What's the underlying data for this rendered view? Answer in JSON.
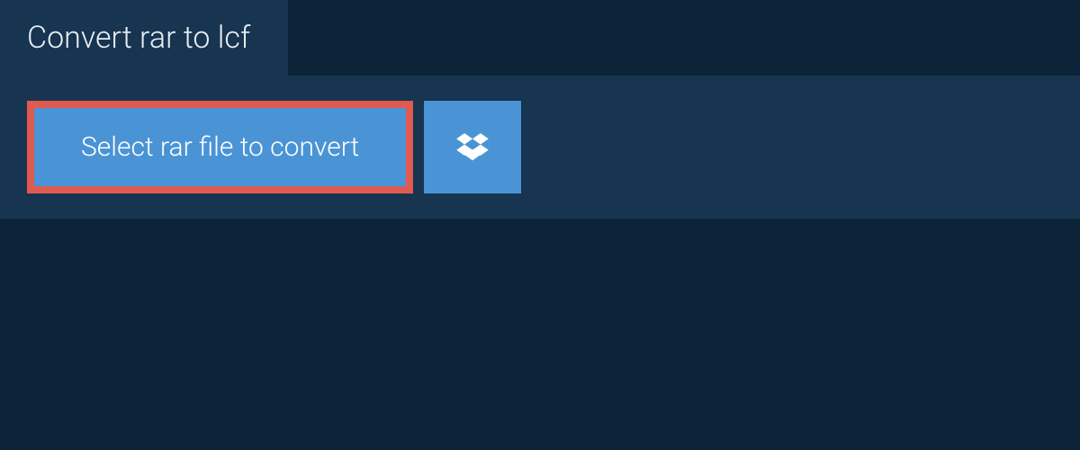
{
  "header": {
    "title": "Convert rar to lcf"
  },
  "upload": {
    "select_button_label": "Select rar file to convert"
  }
}
